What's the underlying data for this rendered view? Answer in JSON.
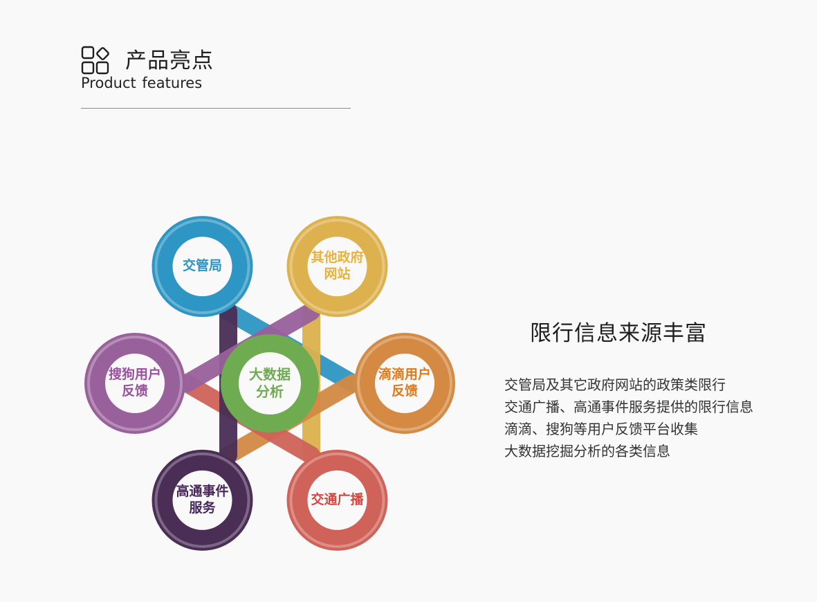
{
  "header": {
    "title": "产品亮点",
    "subtitle": "Product  features"
  },
  "diagram": {
    "center": {
      "line1": "大数据",
      "line2": "分析",
      "color": "#6fab50"
    },
    "petals": [
      {
        "line1": "交管局",
        "line2": "",
        "color": "#2e96c4",
        "text_color": "#2e92c3"
      },
      {
        "line1": "其他政府",
        "line2": "网站",
        "color": "#ddb24e",
        "text_color": "#e8b23c"
      },
      {
        "line1": "滴滴用户",
        "line2": "反馈",
        "color": "#d48a43",
        "text_color": "#e27918"
      },
      {
        "line1": "交通广播",
        "line2": "",
        "color": "#cf6359",
        "text_color": "#d4473f"
      },
      {
        "line1": "高通事件",
        "line2": "服务",
        "color": "#4a2e56",
        "text_color": "#47275a"
      },
      {
        "line1": "搜狗用户",
        "line2": "反馈",
        "color": "#99619c",
        "text_color": "#9b4fa0"
      }
    ]
  },
  "right": {
    "title": "限行信息来源丰富",
    "lines": [
      "交管局及其它政府网站的政策类限行",
      "交通广播、高通事件服务提供的限行信息",
      "滴滴、搜狗等用户反馈平台收集",
      "大数据挖掘分析的各类信息"
    ]
  }
}
